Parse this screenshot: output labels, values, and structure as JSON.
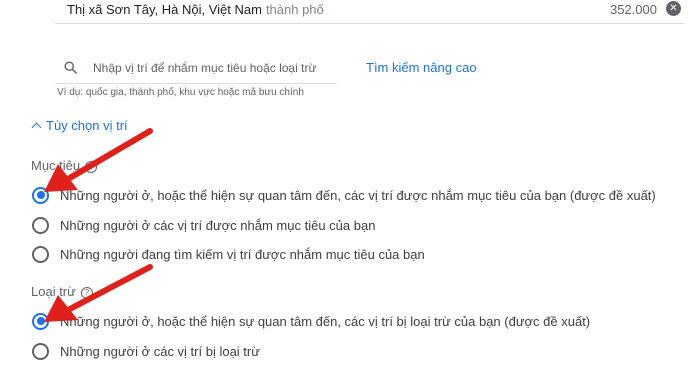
{
  "selected_location": {
    "name": "Thị xã Sơn Tây, Hà Nội, Việt Nam",
    "type": "thành phố",
    "reach": "352.000",
    "remove_icon": "close-circle-icon"
  },
  "search": {
    "placeholder": "Nhập vị trí để nhắm mục tiêu hoặc loại trừ",
    "hint": "Ví dụ: quốc gia, thành phố, khu vực hoặc mã bưu chính",
    "advanced_link": "Tìm kiếm nâng cao",
    "icon": "search-icon"
  },
  "location_options": {
    "toggle_label": "Tùy chọn vị trí",
    "target": {
      "label": "Mục tiêu",
      "options": [
        {
          "label": "Những người ở, hoặc thể hiện sự quan tâm đến, các vị trí được nhắm mục tiêu của bạn (được đề xuất)",
          "selected": true
        },
        {
          "label": "Những người ở các vị trí được nhắm mục tiêu của bạn",
          "selected": false
        },
        {
          "label": "Những người đang tìm kiếm vị trí được nhắm mục tiêu của bạn",
          "selected": false
        }
      ]
    },
    "exclude": {
      "label": "Loại trừ",
      "options": [
        {
          "label": "Những người ở, hoặc thể hiện sự quan tâm đến, các vị trí bị loại trừ của bạn (được đề xuất)",
          "selected": true
        },
        {
          "label": "Những người ở các vị trí bị loại trừ",
          "selected": false
        }
      ]
    }
  },
  "colors": {
    "accent": "#1a73e8",
    "annotation_arrow": "#e0201b"
  }
}
